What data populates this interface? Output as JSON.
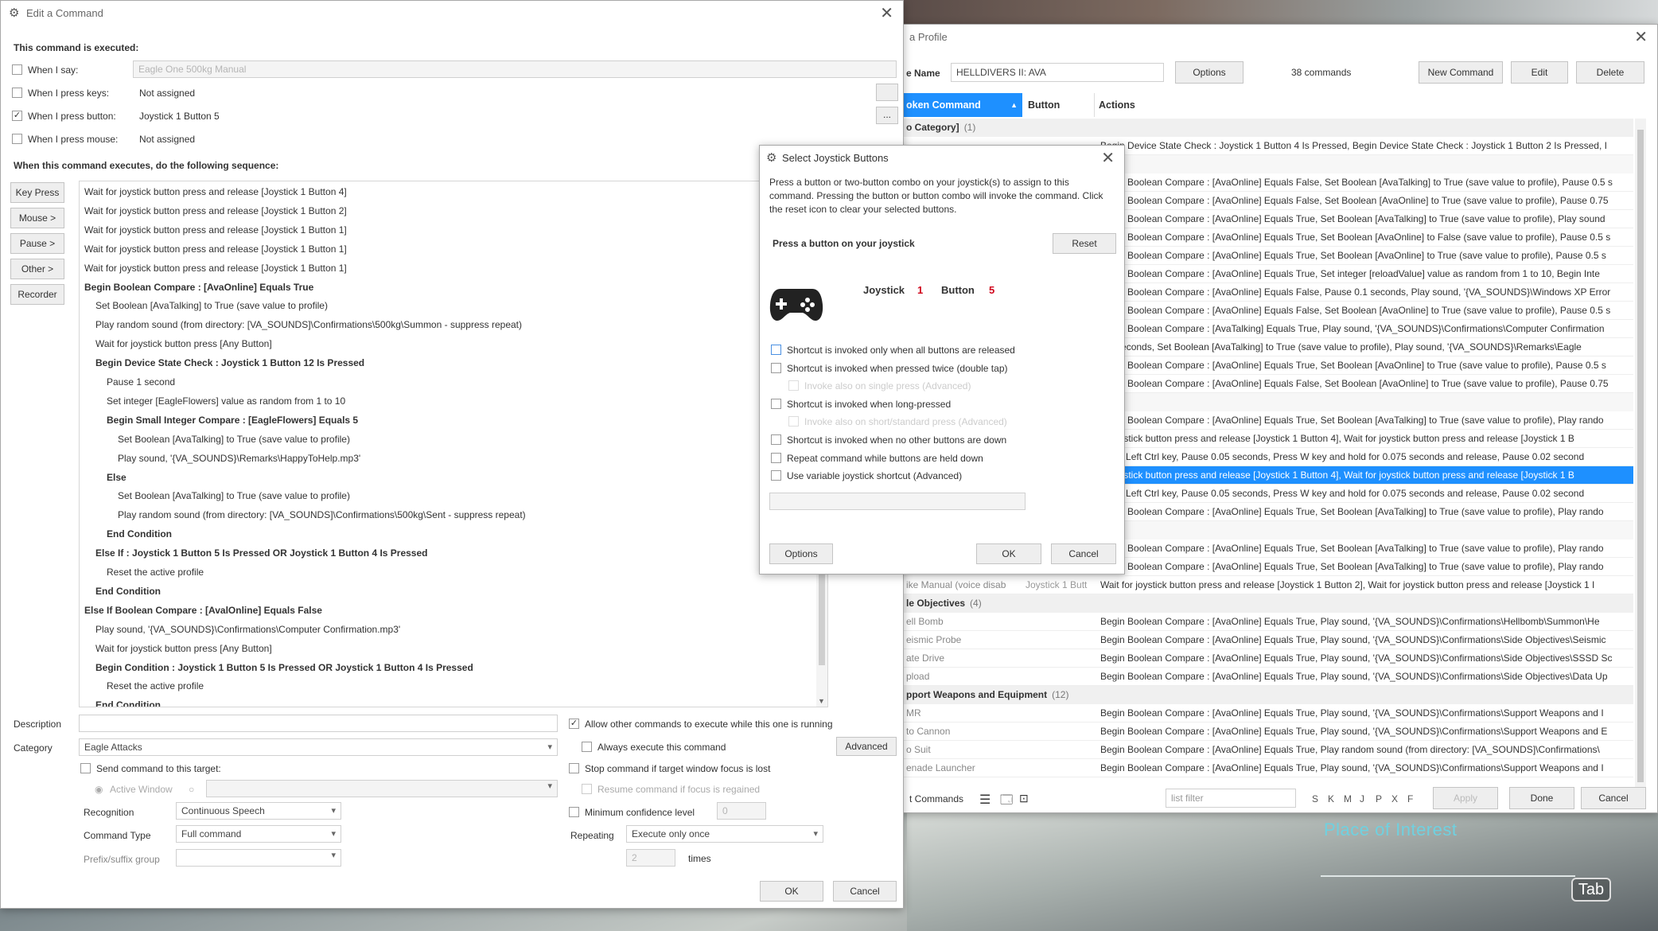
{
  "edit_window": {
    "title": "Edit a Command",
    "executed_heading": "This command is executed:",
    "triggers": [
      {
        "label": "When I say:",
        "value": "Eagle One 500kg Manual",
        "checked": false,
        "disabled": true
      },
      {
        "label": "When I press keys:",
        "value": "Not assigned",
        "checked": false
      },
      {
        "label": "When I press button:",
        "value": "Joystick 1 Button 5",
        "checked": true
      },
      {
        "label": "When I press mouse:",
        "value": "Not assigned",
        "checked": false
      }
    ],
    "sequence_heading": "When this command executes, do the following sequence:",
    "side_buttons": [
      "Key Press",
      "Mouse >",
      "Pause >",
      "Other >",
      "Recorder"
    ],
    "sequence": [
      {
        "t": "Wait for joystick button press and release [Joystick 1 Button 4]",
        "i": 0,
        "b": false
      },
      {
        "t": "Wait for joystick button press and release [Joystick 1 Button 2]",
        "i": 0,
        "b": false
      },
      {
        "t": "Wait for joystick button press and release [Joystick 1 Button 1]",
        "i": 0,
        "b": false
      },
      {
        "t": "Wait for joystick button press and release [Joystick 1 Button 1]",
        "i": 0,
        "b": false
      },
      {
        "t": "Wait for joystick button press and release [Joystick 1 Button 1]",
        "i": 0,
        "b": false
      },
      {
        "t": "Begin Boolean Compare : [AvaOnline] Equals True",
        "i": 0,
        "b": true
      },
      {
        "t": "Set Boolean [AvaTalking] to True (save value to profile)",
        "i": 1,
        "b": false
      },
      {
        "t": "Play random sound (from directory: [VA_SOUNDS]\\Confirmations\\500kg\\Summon - suppress repeat)",
        "i": 1,
        "b": false
      },
      {
        "t": "Wait for joystick button press [Any Button]",
        "i": 1,
        "b": false
      },
      {
        "t": "Begin Device State Check :  Joystick 1 Button 12 Is Pressed",
        "i": 1,
        "b": true
      },
      {
        "t": "Pause 1 second",
        "i": 2,
        "b": false
      },
      {
        "t": "Set integer [EagleFlowers] value as random from 1 to 10",
        "i": 2,
        "b": false
      },
      {
        "t": "Begin Small Integer Compare : [EagleFlowers] Equals 5",
        "i": 2,
        "b": true
      },
      {
        "t": "Set Boolean [AvaTalking] to True (save value to profile)",
        "i": 3,
        "b": false
      },
      {
        "t": "Play sound, '{VA_SOUNDS}\\Remarks\\HappyToHelp.mp3'",
        "i": 3,
        "b": false
      },
      {
        "t": "Else",
        "i": 2,
        "b": true
      },
      {
        "t": "Set Boolean [AvaTalking] to True (save value to profile)",
        "i": 3,
        "b": false
      },
      {
        "t": "Play random sound (from directory: [VA_SOUNDS]\\Confirmations\\500kg\\Sent - suppress repeat)",
        "i": 3,
        "b": false
      },
      {
        "t": "End Condition",
        "i": 2,
        "b": true
      },
      {
        "t": "Else If : Joystick 1 Button 5 Is Pressed OR Joystick 1 Button 4 Is Pressed",
        "i": 1,
        "b": true
      },
      {
        "t": "Reset the active profile",
        "i": 2,
        "b": false
      },
      {
        "t": "End Condition",
        "i": 1,
        "b": true
      },
      {
        "t": "Else If Boolean Compare : [AvalOnline] Equals False",
        "i": 0,
        "b": true
      },
      {
        "t": "Play sound, '{VA_SOUNDS}\\Confirmations\\Computer Confirmation.mp3'",
        "i": 1,
        "b": false
      },
      {
        "t": "Wait for joystick button press [Any Button]",
        "i": 1,
        "b": false
      },
      {
        "t": "Begin Condition : Joystick 1 Button 5 Is Pressed OR Joystick 1 Button 4 Is Pressed",
        "i": 1,
        "b": true
      },
      {
        "t": "Reset the active profile",
        "i": 2,
        "b": false
      },
      {
        "t": "End Condition",
        "i": 1,
        "b": true
      }
    ],
    "description_label": "Description",
    "category_label": "Category",
    "category_value": "Eagle Attacks",
    "send_target_label": "Send command to this target:",
    "active_window_label": "Active Window",
    "recognition_label": "Recognition",
    "recognition_value": "Continuous Speech",
    "command_type_label": "Command Type",
    "command_type_value": "Full command",
    "prefix_label": "Prefix/suffix group",
    "allow_other_label": "Allow other commands to execute while this one is running",
    "always_execute_label": "Always execute this command",
    "stop_focus_label": "Stop command if target window focus is lost",
    "resume_focus_label": "Resume command if focus is regained",
    "min_conf_label": "Minimum confidence level",
    "min_conf_value": "0",
    "repeating_label": "Repeating",
    "repeating_value": "Execute only once",
    "times_value": "2",
    "times_label": "times",
    "advanced_btn": "Advanced",
    "ok_btn": "OK",
    "cancel_btn": "Cancel",
    "ellipsis": "..."
  },
  "profile_window": {
    "title": "a Profile",
    "name_label": "e Name",
    "name_value": "HELLDIVERS II: AVA",
    "options_btn": "Options",
    "commands_count": "38 commands",
    "new_command_btn": "New Command",
    "edit_btn": "Edit",
    "delete_btn": "Delete",
    "col_spoken": "oken Command",
    "col_button": "Button",
    "col_actions": "Actions",
    "rows": [
      {
        "kind": "cat",
        "c": "o Category]",
        "n": "(1)"
      },
      {
        "kind": "row",
        "c": "",
        "b": "",
        "a": "Begin Device State Check :  Joystick 1 Button 4 Is Pressed, Begin Device State Check :  Joystick 1 Button 2 Is Pressed, I"
      },
      {
        "kind": "blank"
      },
      {
        "kind": "row",
        "c": "",
        "b": "",
        "a": "Begin Boolean Compare : [AvaOnline] Equals False, Set Boolean [AvaTalking] to True (save value to profile), Pause 0.5 s"
      },
      {
        "kind": "row",
        "c": "",
        "b": "",
        "a": "Begin Boolean Compare : [AvaOnline] Equals False, Set Boolean [AvaOnline] to True (save value to profile), Pause 0.75"
      },
      {
        "kind": "row",
        "c": "",
        "b": "",
        "a": "Begin Boolean Compare : [AvaOnline] Equals True, Set Boolean [AvaTalking] to True (save value to profile), Play sound"
      },
      {
        "kind": "row",
        "c": "",
        "b": "",
        "a": "Begin Boolean Compare : [AvaOnline] Equals True, Set Boolean [AvaOnline] to False (save value to profile), Pause 0.5 s"
      },
      {
        "kind": "row",
        "c": "",
        "b": "",
        "a": "Begin Boolean Compare : [AvaOnline] Equals True, Set Boolean [AvaOnline] to True (save value to profile), Pause 0.5 s"
      },
      {
        "kind": "row",
        "c": "",
        "b": "",
        "a": "Begin Boolean Compare : [AvaOnline] Equals True, Set integer [reloadValue] value as random from 1 to 10, Begin Inte"
      },
      {
        "kind": "row",
        "c": "",
        "b": "",
        "a": "Begin Boolean Compare : [AvaOnline] Equals False, Pause 0.1 seconds, Play sound, '{VA_SOUNDS}\\Windows XP Error"
      },
      {
        "kind": "row",
        "c": "",
        "b": "",
        "a": "Begin Boolean Compare : [AvaOnline] Equals False, Set Boolean [AvaOnline] to True (save value to profile), Pause 0.5 s"
      },
      {
        "kind": "row",
        "c": "",
        "b": "",
        "a": "Begin Boolean Compare : [AvaTalking] Equals True, Play sound, '{VA_SOUNDS}\\Confirmations\\Computer Confirmation"
      },
      {
        "kind": "row",
        "c": "",
        "b": "",
        "a": "0.5 seconds, Set Boolean [AvaTalking] to True (save value to profile), Play sound, '{VA_SOUNDS}\\Remarks\\Eagle"
      },
      {
        "kind": "row",
        "c": "",
        "b": "",
        "a": "Begin Boolean Compare : [AvaOnline] Equals True, Set Boolean [AvaOnline] to True (save value to profile), Pause 0.5 s"
      },
      {
        "kind": "row",
        "c": "",
        "b": "",
        "a": "Begin Boolean Compare : [AvaOnline] Equals False, Set Boolean [AvaOnline] to True (save value to profile), Pause 0.75"
      },
      {
        "kind": "blank"
      },
      {
        "kind": "row",
        "c": "",
        "b": "",
        "a": "Begin Boolean Compare : [AvaOnline] Equals True, Set Boolean [AvaTalking] to True (save value to profile), Play rando"
      },
      {
        "kind": "row",
        "c": "",
        "b": "",
        "a": "or joystick button press and release [Joystick 1 Button 4], Wait for joystick button press and release [Joystick 1 B"
      },
      {
        "kind": "row",
        "c": "",
        "b": "",
        "a": "down Left Ctrl key, Pause 0.05 seconds, Press W key and hold for 0.075 seconds and release, Pause 0.02 second"
      },
      {
        "kind": "sel",
        "c": "",
        "b": "",
        "a": "or joystick button press and release [Joystick 1 Button 4], Wait for joystick button press and release [Joystick 1 B"
      },
      {
        "kind": "row",
        "c": "",
        "b": "",
        "a": "down Left Ctrl key, Pause 0.05 seconds, Press W key and hold for 0.075 seconds and release, Pause 0.02 second"
      },
      {
        "kind": "row",
        "c": "",
        "b": "",
        "a": "Begin Boolean Compare : [AvaOnline] Equals True, Set Boolean [AvaTalking] to True (save value to profile), Play rando"
      },
      {
        "kind": "blank"
      },
      {
        "kind": "row",
        "c": "",
        "b": "",
        "a": "Begin Boolean Compare : [AvaOnline] Equals True, Set Boolean [AvaTalking] to True (save value to profile), Play rando"
      },
      {
        "kind": "row",
        "c": "",
        "b": "",
        "a": "Begin Boolean Compare : [AvaOnline] Equals True, Set Boolean [AvaTalking] to True (save value to profile), Play rando"
      },
      {
        "kind": "row",
        "c": "ike Manual  (voice disab",
        "b": "Joystick 1 Butt",
        "a": "Wait for joystick button press and release [Joystick 1 Button 2], Wait for joystick button press and release [Joystick 1 I"
      },
      {
        "kind": "cat",
        "c": "le Objectives",
        "n": "(4)"
      },
      {
        "kind": "row",
        "c": "ell Bomb",
        "b": "",
        "a": "Begin Boolean Compare : [AvaOnline] Equals True, Play sound, '{VA_SOUNDS}\\Confirmations\\Hellbomb\\Summon\\He"
      },
      {
        "kind": "row",
        "c": "eismic Probe",
        "b": "",
        "a": "Begin Boolean Compare : [AvaOnline] Equals True, Play sound, '{VA_SOUNDS}\\Confirmations\\Side Objectives\\Seismic"
      },
      {
        "kind": "row",
        "c": "ate Drive",
        "b": "",
        "a": "Begin Boolean Compare : [AvaOnline] Equals True, Play sound, '{VA_SOUNDS}\\Confirmations\\Side Objectives\\SSSD Sc"
      },
      {
        "kind": "row",
        "c": "pload",
        "b": "",
        "a": "Begin Boolean Compare : [AvaOnline] Equals True, Play sound, '{VA_SOUNDS}\\Confirmations\\Side Objectives\\Data Up"
      },
      {
        "kind": "cat",
        "c": "pport Weapons and Equipment",
        "n": "(12)"
      },
      {
        "kind": "row",
        "c": "MR",
        "b": "",
        "a": "Begin Boolean Compare : [AvaOnline] Equals True, Play sound, '{VA_SOUNDS}\\Confirmations\\Support Weapons and I"
      },
      {
        "kind": "row",
        "c": "to Cannon",
        "b": "",
        "a": "Begin Boolean Compare : [AvaOnline] Equals True, Play sound, '{VA_SOUNDS}\\Confirmations\\Support Weapons and E"
      },
      {
        "kind": "row",
        "c": "o Suit",
        "b": "",
        "a": "Begin Boolean Compare : [AvaOnline] Equals True, Play random sound (from directory: [VA_SOUNDS]\\Confirmations\\"
      },
      {
        "kind": "row",
        "c": "enade Launcher",
        "b": "",
        "a": "Begin Boolean Compare : [AvaOnline] Equals True, Play sound, '{VA_SOUNDS}\\Confirmations\\Support Weapons and I"
      }
    ],
    "bottom_commands": "t Commands",
    "list_filter_placeholder": "list filter",
    "filter_letters": [
      "S",
      "K",
      "M",
      "J",
      "P",
      "X",
      "F"
    ],
    "apply_btn": "Apply",
    "done_btn": "Done",
    "cancel_btn": "Cancel"
  },
  "joystick_dialog": {
    "title": "Select Joystick Buttons",
    "instructions": "Press a button or two-button combo on your joystick(s) to assign to this command.  Pressing the button or button combo will invoke the command. Click the reset icon to clear your selected buttons.",
    "prompt": "Press a button on your joystick",
    "reset_btn": "Reset",
    "joystick_label": "Joystick",
    "joystick_num": "1",
    "button_label": "Button",
    "button_num": "5",
    "options": [
      {
        "label": "Shortcut is invoked only when all buttons are released",
        "dim": false,
        "sub": false
      },
      {
        "label": "Shortcut is invoked when pressed twice (double tap)",
        "dim": false,
        "sub": false
      },
      {
        "label": "Invoke also on single press (Advanced)",
        "dim": true,
        "sub": true
      },
      {
        "label": "Shortcut is invoked when long-pressed",
        "dim": false,
        "sub": false
      },
      {
        "label": "Invoke also on short/standard press (Advanced)",
        "dim": true,
        "sub": true
      },
      {
        "label": "Shortcut is invoked when no other buttons are down",
        "dim": false,
        "sub": false
      },
      {
        "label": "Repeat command while buttons are held down",
        "dim": false,
        "sub": false
      },
      {
        "label": "Use variable joystick shortcut (Advanced)",
        "dim": false,
        "sub": false
      }
    ],
    "options_btn": "Options",
    "ok_btn": "OK",
    "cancel_btn": "Cancel"
  },
  "game": {
    "poi_label": "Place of Interest",
    "tab_key": "Tab"
  },
  "colors": {
    "selection": "#1e90ff",
    "accent_red": "#d0021b"
  }
}
